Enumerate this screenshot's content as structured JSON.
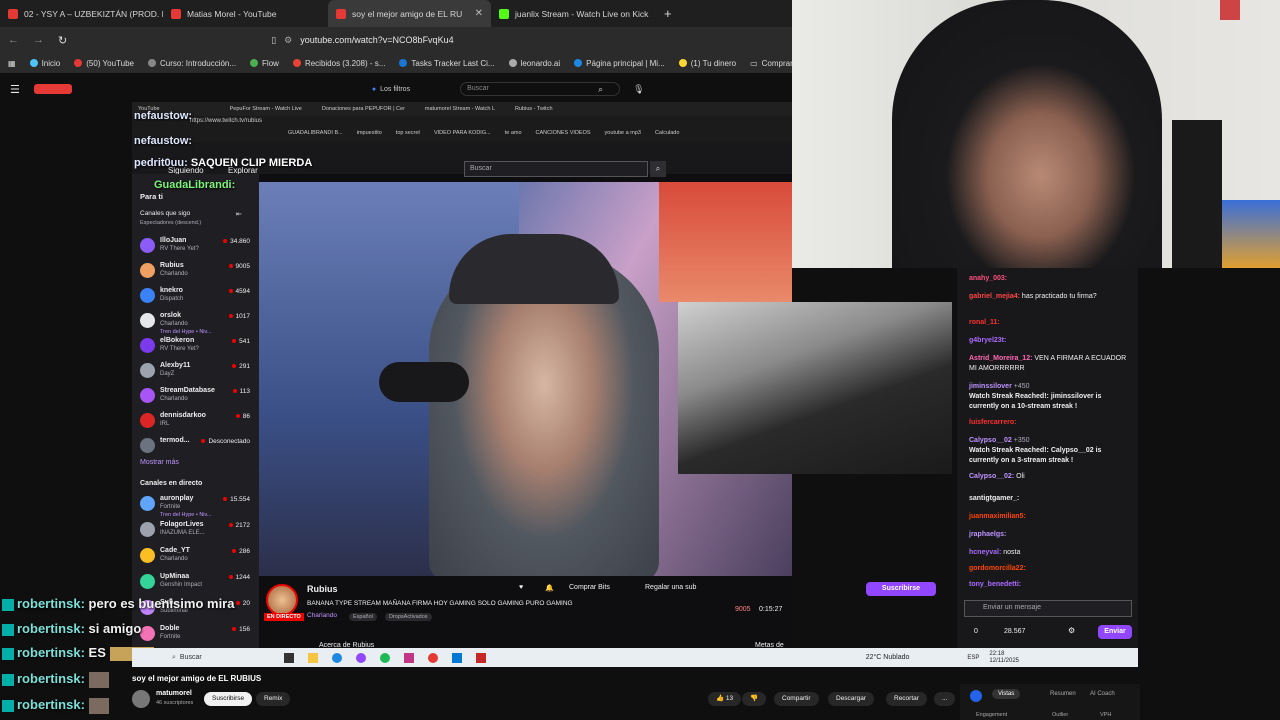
{
  "browser": {
    "tabs": [
      {
        "label": "02 - YSY A – UZBEKIZTÁN (PROD. EV",
        "color": "#e53935"
      },
      {
        "label": "Matias Morel - YouTube",
        "color": "#e53935"
      },
      {
        "label": "soy el mejor amigo de EL RUB",
        "color": "#e53935",
        "active": true
      },
      {
        "label": "juanlix Stream - Watch Live on Kick",
        "color": "#53fc18"
      }
    ],
    "new_tab": "+",
    "url": "youtube.com/watch?v=NCO8bFvqKu4",
    "bookmarks": [
      "Inicio",
      "(50) YouTube",
      "Curso: Introducción...",
      "Flow",
      "Recibidos (3.208) - s...",
      "Tasks Tracker Last Ci...",
      "leonardo.ai",
      "Página principal | Mi...",
      "(1) Tu dinero",
      "Comprar"
    ],
    "yt_search_placeholder": "Buscar",
    "yt_filter_label": "Los filtros"
  },
  "inner": {
    "tabs": [
      "YouTube",
      "PepuFor Stream - Watch Live",
      "Donaciones para PEPUFOR | Cer",
      "matumorel Stream - Watch L",
      "Rubius - Twitch"
    ],
    "url": "https://www.twitch.tv/rubius",
    "bookmarks": [
      "GUADALIBRANDI B...",
      "impuestito",
      "top secret",
      "VIDEO PARA KODIG...",
      "te amo",
      "CANCIONES VIDEOS",
      "youtube a mp3",
      "Calculado"
    ],
    "nav": [
      "Siguiendo",
      "Explorar"
    ],
    "search_placeholder": "Buscar",
    "sidebar_title": "Para ti",
    "sidebar_sub": "Canales que sigo",
    "sidebar_sort": "Espectadores (descend.)",
    "channels": [
      {
        "name": "IlloJuan",
        "game": "RV There Yet?",
        "viewers": "34.860",
        "color": "#8b5cf6"
      },
      {
        "name": "Rubius",
        "game": "Charlando",
        "viewers": "9005",
        "color": "#f0a060"
      },
      {
        "name": "knekro",
        "game": "Dispatch",
        "viewers": "4594",
        "color": "#3b82f6"
      },
      {
        "name": "orslok",
        "game": "Charlando",
        "viewers": "1017",
        "color": "#e5e7eb",
        "hype": "Tren del Hype • Niv..."
      },
      {
        "name": "elBokeron",
        "game": "RV There Yet?",
        "viewers": "541",
        "color": "#7c3aed"
      },
      {
        "name": "Alexby11",
        "game": "DayZ",
        "viewers": "291",
        "color": "#9ca3af"
      },
      {
        "name": "StreamDatabase",
        "game": "Charlando",
        "viewers": "113",
        "color": "#a855f7"
      },
      {
        "name": "dennisdarkoo",
        "game": "IRL",
        "viewers": "86",
        "color": "#dc2626"
      },
      {
        "name": "termod...",
        "game": "",
        "viewers": "Desconectado",
        "color": "#6b7280"
      }
    ],
    "show_more": "Mostrar más",
    "live_title": "Canales en directo",
    "live_channels": [
      {
        "name": "auronplay",
        "game": "Fortnite",
        "viewers": "15.554",
        "color": "#60a5fa",
        "hype": "Tren del Hype • Niv..."
      },
      {
        "name": "FolagorLives",
        "game": "INAZUMA ELE...",
        "viewers": "2172",
        "color": "#9ca3af"
      },
      {
        "name": "Cade_YT",
        "game": "Charlando",
        "viewers": "286",
        "color": "#fbbf24"
      },
      {
        "name": "UpMinaa",
        "game": "Genshin Impact",
        "viewers": "1244",
        "color": "#34d399"
      },
      {
        "name": "Sub...",
        "game": "Subliminal",
        "viewers": "20",
        "color": "#c084fc"
      },
      {
        "name": "Doble",
        "game": "Fortnite",
        "viewers": "156",
        "color": "#f472b6"
      }
    ],
    "streamer": "Rubius",
    "live_badge": "EN DIRECTO",
    "stream_title": "BANANA TYPE STREAM MAÑANA FIRMA HOY GAMING SOLO GAMING PURO GAMING",
    "stream_category": "Charlando",
    "tags": [
      "Español",
      "DropsActivados"
    ],
    "viewers": "9005",
    "uptime": "0:15:27",
    "buttons": {
      "bits": "Comprar Bits",
      "gift": "Regalar una sub",
      "subscribe": "Suscribirse"
    },
    "about": "Acerca de Rubius",
    "goals": "Metas de Rubius",
    "overlay_top": [
      {
        "user": "nefaustow:",
        "text": ""
      },
      {
        "user": "nefaustow:",
        "text": ""
      },
      {
        "user": "pedrit0uu:",
        "text": "SAQUEN CLIP MIERDA"
      },
      {
        "user": "GuadaLibrandi:",
        "text": ""
      }
    ]
  },
  "chat": {
    "messages": [
      {
        "user": "anahy_003:",
        "text": "",
        "color": "#ff4f7e"
      },
      {
        "user": "gabriel_mejia4:",
        "text": "has practicado tu firma?",
        "color": "#ff4545"
      },
      {
        "user": "ronal_11:",
        "text": "",
        "color": "#ff3030"
      },
      {
        "user": "g4bryel23t:",
        "text": "",
        "color": "#ab6bff"
      },
      {
        "user": "Astrid_Moreira_12:",
        "text": "VEN A FIRMAR A ECUADOR MI AMORRRRRR",
        "color": "#ff69b4"
      },
      {
        "user": "jiminssilover",
        "text": "Watch Streak Reached!: jiminssilover is currently on a 10-stream streak !",
        "color": "#bf94ff",
        "points": "+450"
      },
      {
        "user": "luisfercarrero:",
        "text": "",
        "color": "#ff3030"
      },
      {
        "user": "Calypso__02",
        "text": "Watch Streak Reached!: Calypso__02 is currently on a 3-stream streak !",
        "color": "#bf94ff",
        "points": "+350"
      },
      {
        "user": "Calypso__02:",
        "text": "Oli",
        "color": "#bf94ff"
      },
      {
        "user": "santigtgamer_:",
        "text": "",
        "color": "#efeff1"
      },
      {
        "user": "juanmaximilian5:",
        "text": "",
        "color": "#ff4500"
      },
      {
        "user": "jraphaelgs:",
        "text": "",
        "color": "#bf94ff"
      },
      {
        "user": "hcneyval:",
        "text": "nosta",
        "color": "#ab6bff"
      },
      {
        "user": "gordomorcilla22:",
        "text": "",
        "color": "#ff4500"
      },
      {
        "user": "tony_benedetti:",
        "text": "",
        "color": "#ab6bff"
      }
    ],
    "input_placeholder": "Enviar un mensaje",
    "points_a": "0",
    "points_b": "28.567",
    "send": "Enviar"
  },
  "overlay_chat": [
    {
      "user": "robertinsk:",
      "text": "pero es buenisimo mira"
    },
    {
      "user": "robertinsk:",
      "text": "si amigo"
    },
    {
      "user": "robertinsk:",
      "text": "ES"
    },
    {
      "user": "robertinsk:",
      "text": ""
    },
    {
      "user": "robertinsk:",
      "text": ""
    }
  ],
  "taskbar": {
    "search": "Buscar",
    "weather": "22°C  Nublado",
    "lang": "ESP",
    "time": "22:18",
    "date": "12/11/2025"
  },
  "youtube": {
    "video_title": "soy el mejor amigo de EL RUBIUS",
    "channel": "matumorel",
    "subs": "46 suscriptores",
    "subscribe": "Suscribirse",
    "remix": "Remix",
    "likes": "13",
    "share": "Compartir",
    "download": "Descargar",
    "clip": "Recortar",
    "more": "...",
    "panel_tabs": [
      "Vistas",
      "Resumen",
      "AI Coach"
    ],
    "panel_tabs2": [
      "Engagement",
      "Outlier",
      "VPH"
    ]
  }
}
